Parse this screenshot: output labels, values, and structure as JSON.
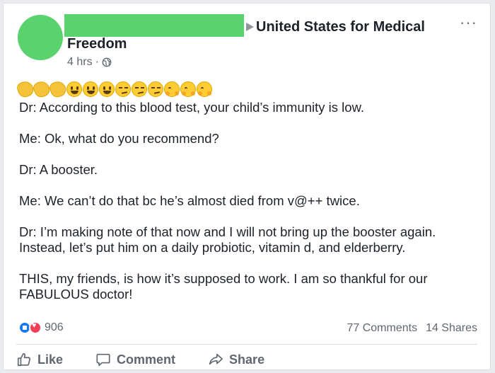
{
  "post": {
    "group_name_line1": "United States for Medical",
    "group_name_line2": "Freedom",
    "time": "4 hrs",
    "separator": "·",
    "more_label": "···",
    "emoji_row": [
      "clapping-hands",
      "clapping-hands",
      "clapping-hands",
      "grinning-face",
      "grinning-face",
      "grinning-face",
      "smirking-face",
      "smirking-face",
      "smirking-face",
      "hugging-face",
      "hugging-face",
      "hugging-face"
    ],
    "paragraphs": [
      "Dr: According to this blood test, your child’s immunity is low.",
      "Me: Ok, what do you recommend?",
      "Dr: A booster.",
      "Me: We can’t do that bc he’s almost died from v@++ twice.",
      "Dr:  I’m making note of that now and I will not bring up the booster again. Instead, let’s put him on a daily probiotic, vitamin d, and elderberry.",
      "THIS, my friends, is how it’s supposed to work. I am so thankful for our FABULOUS doctor!"
    ]
  },
  "engagement": {
    "reaction_count": "906",
    "comments": "77 Comments",
    "shares": "14 Shares"
  },
  "actions": {
    "like": "Like",
    "comment": "Comment",
    "share": "Share"
  },
  "colors": {
    "redaction": "#5ad36e",
    "like_blue": "#1877f2",
    "love_red": "#f33e58"
  }
}
